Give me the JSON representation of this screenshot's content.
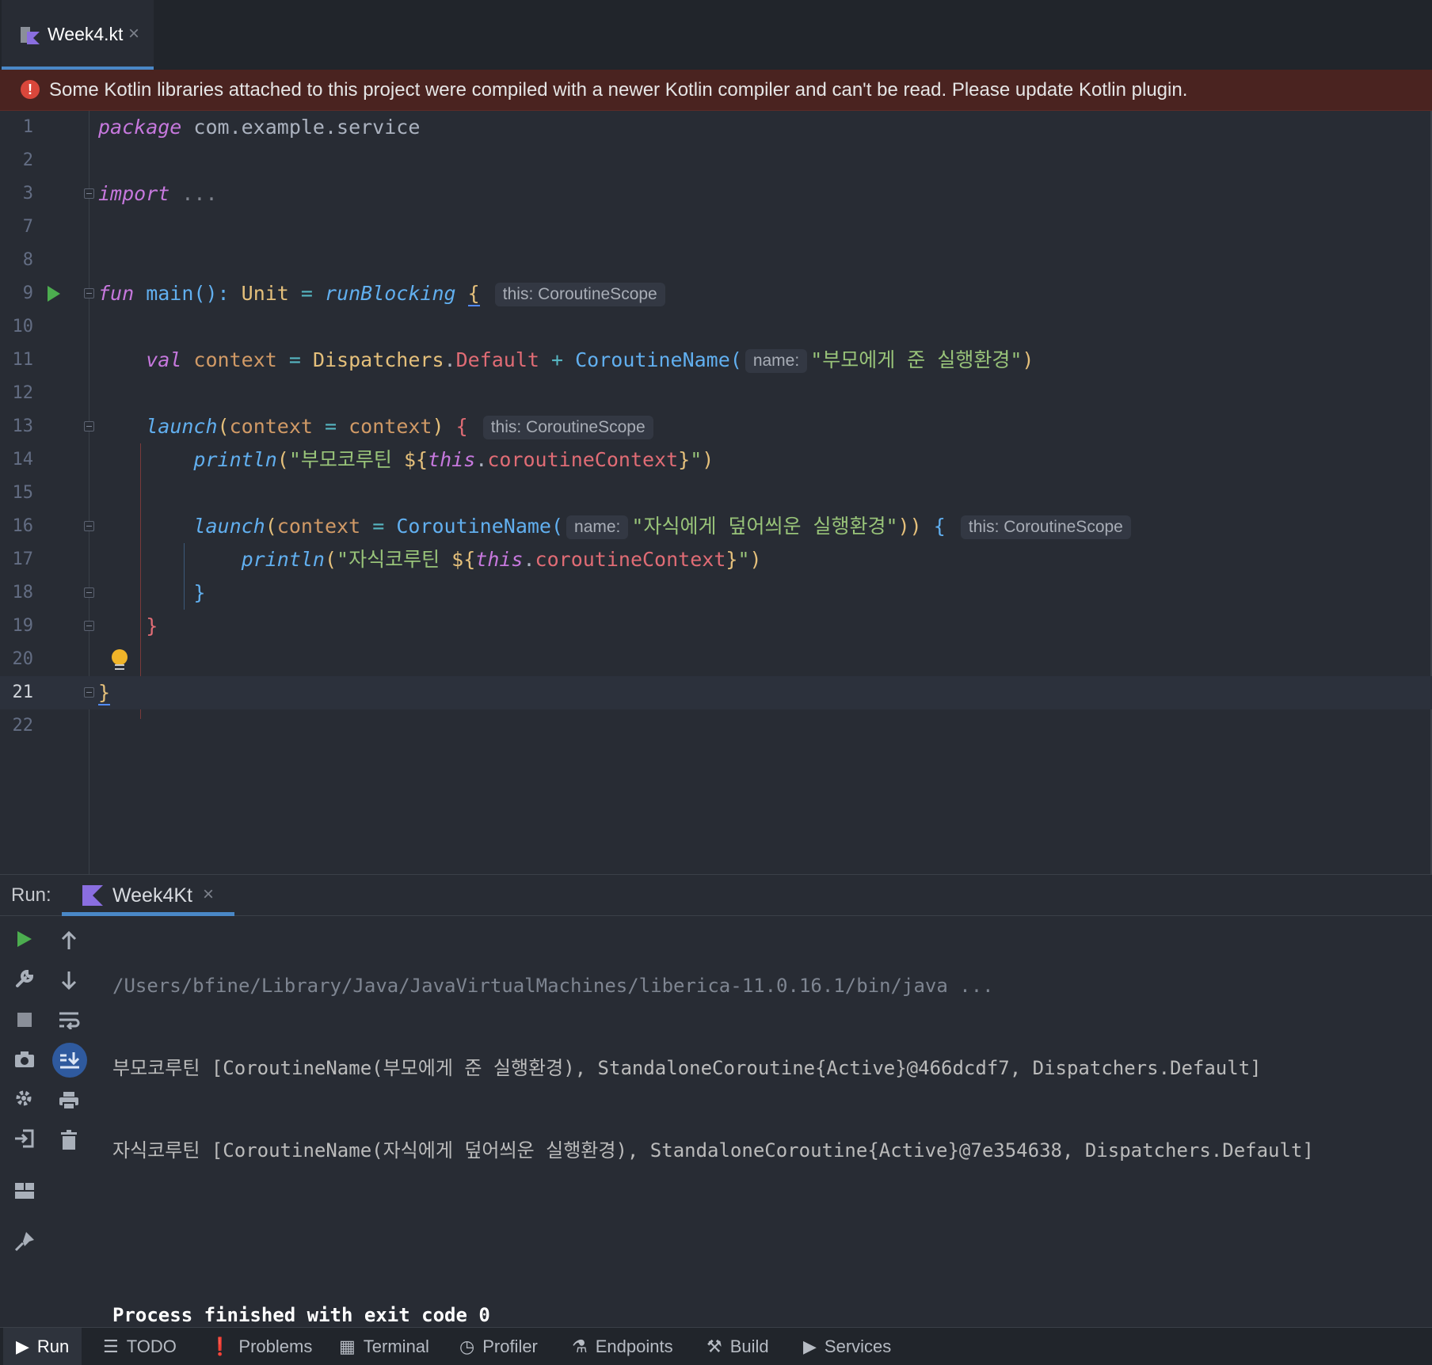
{
  "tab": {
    "filename": "Week4.kt",
    "close": "×"
  },
  "banner": {
    "text": "Some Kotlin libraries attached to this project were compiled with a newer Kotlin compiler and can't be read. Please update Kotlin plugin."
  },
  "editor": {
    "line_numbers": [
      "1",
      "2",
      "3",
      "7",
      "8",
      "9",
      "10",
      "11",
      "12",
      "13",
      "14",
      "15",
      "16",
      "17",
      "18",
      "19",
      "20",
      "21",
      "22"
    ],
    "current_line": "21",
    "tokens": {
      "l1_kw": "package",
      "l1_pkg": " com.example.service",
      "l3_kw": "import",
      "l3_dots": " ...",
      "l9_fun": "fun",
      "l9_main": " main",
      "l9_paren": "(): ",
      "l9_unit": "Unit",
      "l9_eq": " = ",
      "l9_rb": "runBlocking",
      "l9_brace": "{",
      "l9_hint": "this: CoroutineScope",
      "l11_val": "val",
      "l11_ctx": " context",
      "l11_eq": " = ",
      "l11_disp": "Dispatchers",
      "l11_dot": ".",
      "l11_def": "Default",
      "l11_plus": " + ",
      "l11_cn": "CoroutineName(",
      "l11_hint": "name:",
      "l11_str": "\"부모에게 준 실행환경\"",
      "l11_close": ")",
      "l13_launch": "launch",
      "l13_open": "(",
      "l13_ctx": "context",
      "l13_eq": " = ",
      "l13_ctx2": "context",
      "l13_close": ") ",
      "l13_brace": "{",
      "l13_hint": "this: CoroutineScope",
      "l14_println": "println",
      "l14_open": "(",
      "l14_str1": "\"부모코루틴 ",
      "l14_dollar": "${",
      "l14_this": "this",
      "l14_dot": ".",
      "l14_prop": "coroutineContext",
      "l14_cb": "}",
      "l14_str2": "\"",
      "l14_close": ")",
      "l16_launch": "launch",
      "l16_open": "(",
      "l16_ctx": "context",
      "l16_eq": " = ",
      "l16_cn": "CoroutineName(",
      "l16_hint": "name:",
      "l16_str": "\"자식에게 덮어씌운 실행환경\"",
      "l16_close": ")) ",
      "l16_brace": "{",
      "l16_hint2": "this: CoroutineScope",
      "l17_println": "println",
      "l17_open": "(",
      "l17_str1": "\"자식코루틴 ",
      "l17_dollar": "${",
      "l17_this": "this",
      "l17_dot": ".",
      "l17_prop": "coroutineContext",
      "l17_cb": "}",
      "l17_str2": "\"",
      "l17_close": ")",
      "l18_brace": "}",
      "l19_brace": "}",
      "l21_brace": "}"
    }
  },
  "run": {
    "label": "Run:",
    "tab": "Week4Kt",
    "close": "×",
    "output": {
      "cmd": "/Users/bfine/Library/Java/JavaVirtualMachines/liberica-11.0.16.1/bin/java ...",
      "line1": "부모코루틴 [CoroutineName(부모에게 준 실행환경), StandaloneCoroutine{Active}@466dcdf7, Dispatchers.Default]",
      "line2": "자식코루틴 [CoroutineName(자식에게 덮어씌운 실행환경), StandaloneCoroutine{Active}@7e354638, Dispatchers.Default]",
      "finished": "Process finished with exit code 0"
    }
  },
  "stripe": {
    "items": [
      "Run",
      "TODO",
      "Problems",
      "Terminal",
      "Profiler",
      "Endpoints",
      "Build",
      "Services"
    ]
  },
  "colors": {
    "accent": "#4a88c7",
    "error_bg": "#4a2320",
    "run_green": "#4cad4f"
  }
}
